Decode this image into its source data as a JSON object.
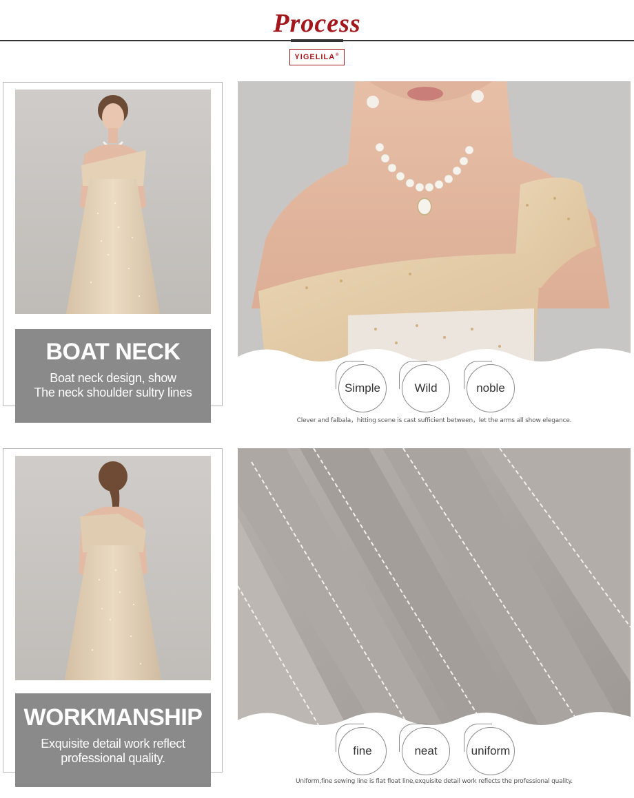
{
  "header": {
    "title": "Process",
    "brand": "YIGELILA",
    "brand_mark": "®"
  },
  "sections": [
    {
      "label_title": "BOAT NECK",
      "label_desc_line1": "Boat neck design, show",
      "label_desc_line2": "The neck shoulder sultry lines",
      "features": [
        "Simple",
        "Wild",
        "noble"
      ],
      "caption": "Clever and falbala，hitting scene is cast sufficient between，let the arms all show elegance."
    },
    {
      "label_title": "WORKMANSHIP",
      "label_desc_line1": "Exquisite detail work reflect",
      "label_desc_line2": "professional quality.",
      "features": [
        "fine",
        "neat",
        "uniform"
      ],
      "caption": "Uniform,fine sewing line is flat float line,exquisite detail work reflects the professional quality."
    }
  ],
  "colors": {
    "accent": "#a3161b",
    "label_box": "#8a8a8a",
    "backdrop": "#c9c6c3",
    "dress": "#e6d3b8",
    "fabric": "#a9a3a0"
  }
}
